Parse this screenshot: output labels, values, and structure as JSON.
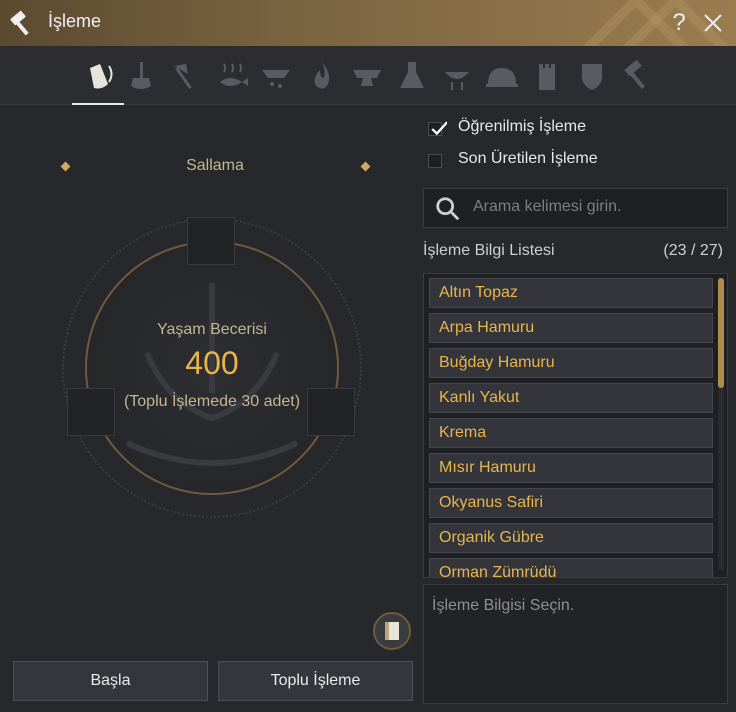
{
  "window": {
    "title": "İşleme",
    "help": "?"
  },
  "colors": {
    "accent": "#e8b54a",
    "label": "#c6b591",
    "bronze": "#6f5a3f"
  },
  "tabs": [
    {
      "name": "tab-shaking",
      "icon": "shaking-bottle-icon",
      "active": true
    },
    {
      "name": "tab-grinding",
      "icon": "grinding-icon"
    },
    {
      "name": "tab-chopping",
      "icon": "axe-icon"
    },
    {
      "name": "tab-drying",
      "icon": "drying-fish-icon"
    },
    {
      "name": "tab-filtering",
      "icon": "filter-icon"
    },
    {
      "name": "tab-heating",
      "icon": "flame-icon"
    },
    {
      "name": "tab-smithing",
      "icon": "anvil-icon"
    },
    {
      "name": "tab-alchemy",
      "icon": "flask-icon"
    },
    {
      "name": "tab-grilling",
      "icon": "grill-icon"
    },
    {
      "name": "tab-cooking",
      "icon": "cloche-icon"
    },
    {
      "name": "tab-castle",
      "icon": "tower-icon"
    },
    {
      "name": "tab-guild",
      "icon": "crest-icon"
    },
    {
      "name": "tab-hammer",
      "icon": "hammer-icon"
    }
  ],
  "left": {
    "recipe_name": "Sallama",
    "skill_label": "Yaşam Becerisi",
    "skill_value": "400",
    "batch_note": "(Toplu İşlemede 30 adet)",
    "start_button": "Başla",
    "batch_button": "Toplu İşleme"
  },
  "filters": {
    "learned": {
      "label": "Öğrenilmiş İşleme",
      "checked": true
    },
    "recent": {
      "label": "Son Üretilen İşleme",
      "checked": false
    }
  },
  "search": {
    "placeholder": "Arama kelimesi girin."
  },
  "list": {
    "title": "İşleme Bilgi Listesi",
    "count": "(23 / 27)",
    "items": [
      "Altın Topaz",
      "Arpa Hamuru",
      "Buğday Hamuru",
      "Kanlı Yakut",
      "Krema",
      "Mısır Hamuru",
      "Okyanus Safiri",
      "Organik Gübre",
      "Orman Zümrüdü"
    ]
  },
  "info": {
    "placeholder": "İşleme Bilgisi Seçin."
  }
}
